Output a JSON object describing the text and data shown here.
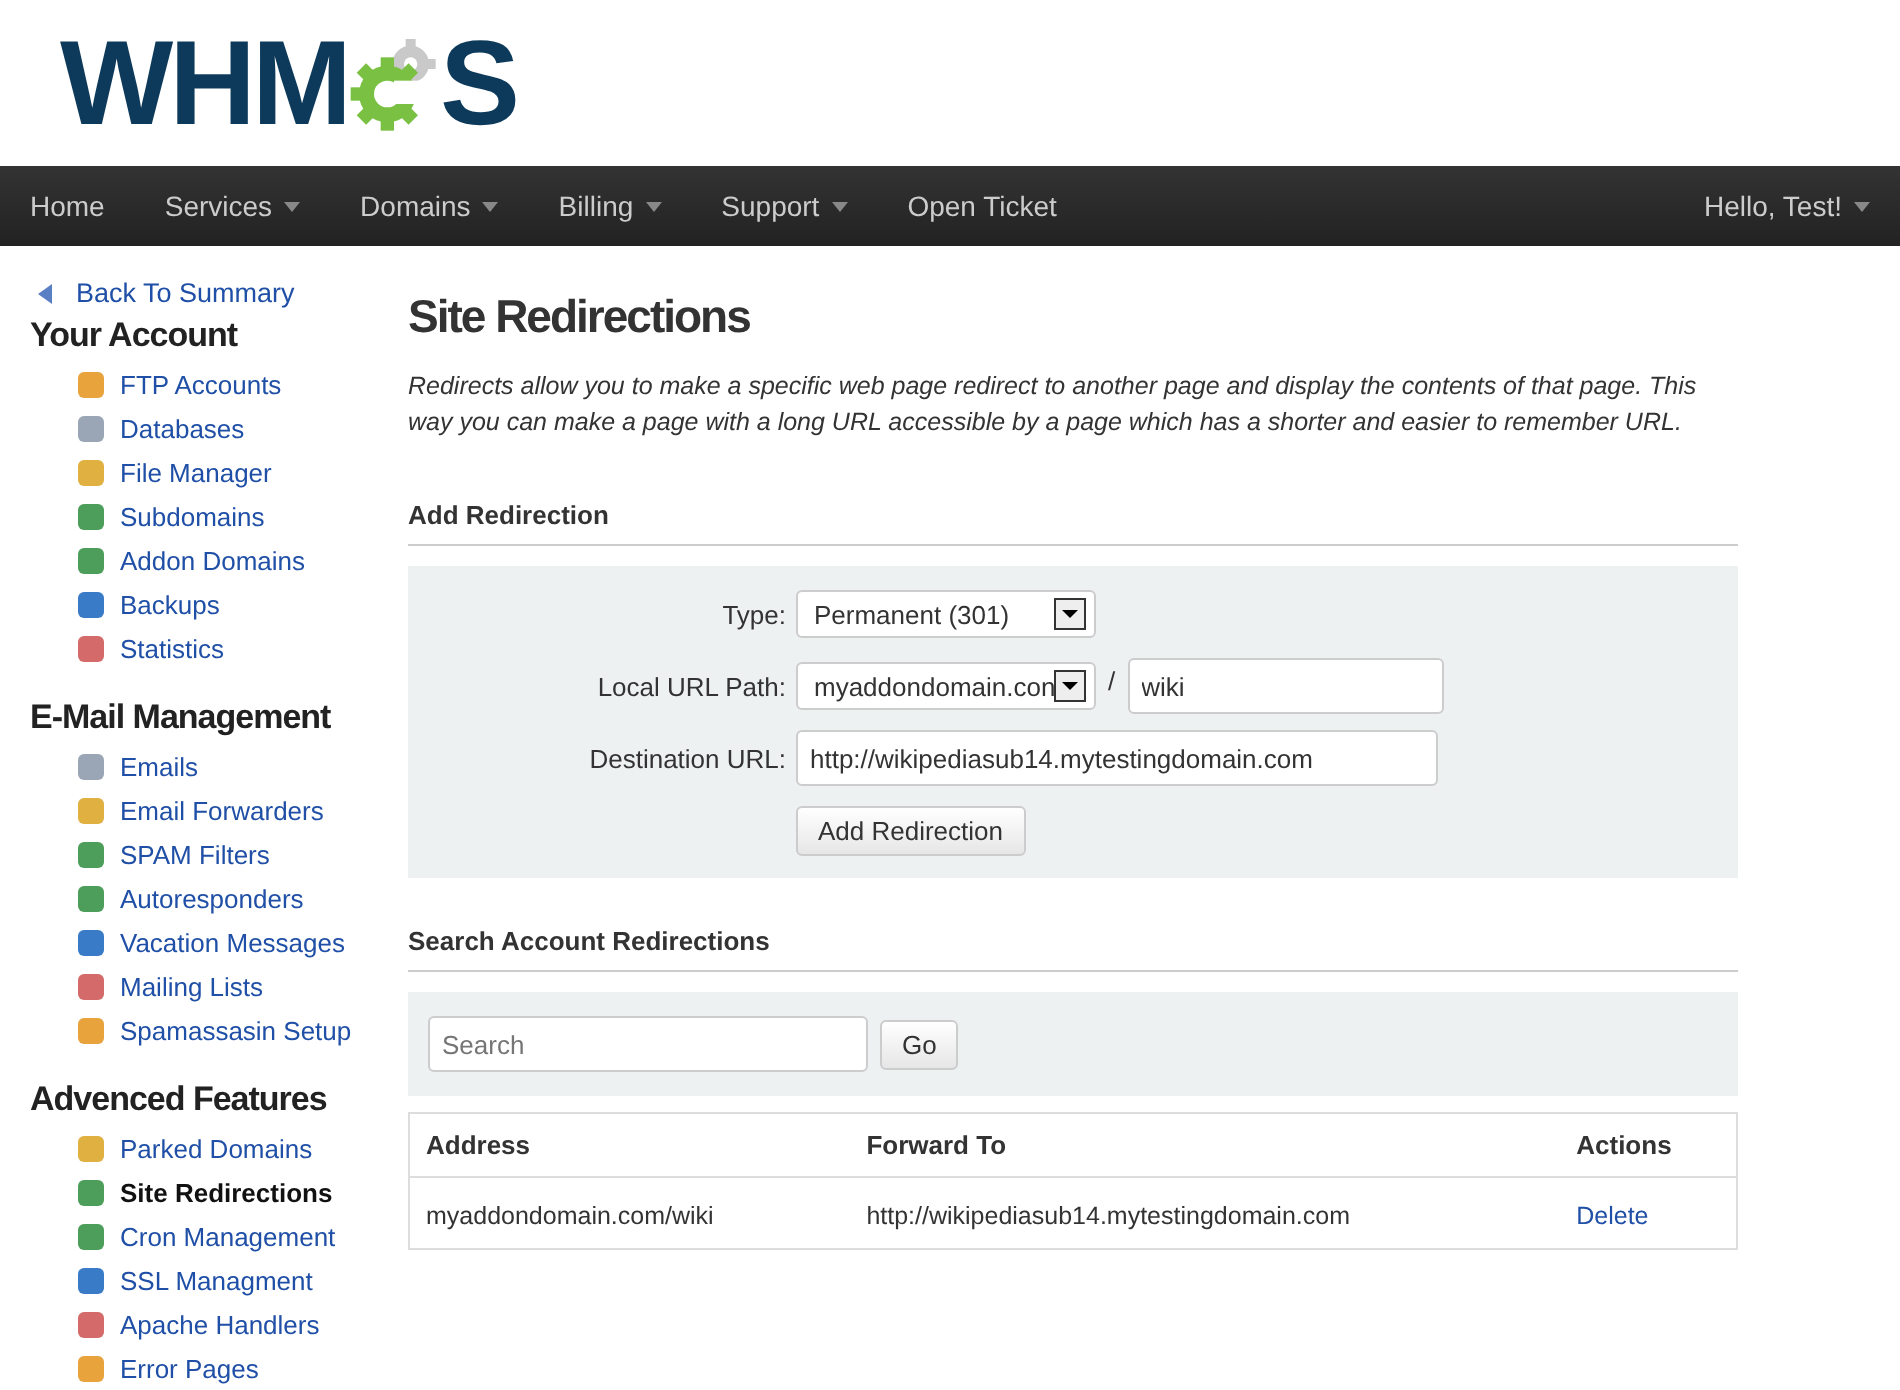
{
  "logo": {
    "left": "WHM",
    "right": "S"
  },
  "nav": {
    "items": [
      {
        "label": "Home",
        "dropdown": false
      },
      {
        "label": "Services",
        "dropdown": true
      },
      {
        "label": "Domains",
        "dropdown": true
      },
      {
        "label": "Billing",
        "dropdown": true
      },
      {
        "label": "Support",
        "dropdown": true
      },
      {
        "label": "Open Ticket",
        "dropdown": false
      }
    ],
    "user": {
      "label": "Hello, Test!",
      "dropdown": true
    }
  },
  "sidebar": {
    "back": "Back To Summary",
    "sections": [
      {
        "title": "Your Account",
        "items": [
          {
            "label": "FTP Accounts",
            "selected": false
          },
          {
            "label": "Databases",
            "selected": false
          },
          {
            "label": "File Manager",
            "selected": false
          },
          {
            "label": "Subdomains",
            "selected": false
          },
          {
            "label": "Addon Domains",
            "selected": false
          },
          {
            "label": "Backups",
            "selected": false
          },
          {
            "label": "Statistics",
            "selected": false
          }
        ]
      },
      {
        "title": "E-Mail Management",
        "items": [
          {
            "label": "Emails",
            "selected": false
          },
          {
            "label": "Email Forwarders",
            "selected": false
          },
          {
            "label": "SPAM Filters",
            "selected": false
          },
          {
            "label": "Autoresponders",
            "selected": false
          },
          {
            "label": "Vacation Messages",
            "selected": false
          },
          {
            "label": "Mailing Lists",
            "selected": false
          },
          {
            "label": "Spamassasin Setup",
            "selected": false
          }
        ]
      },
      {
        "title": "Advenced Features",
        "items": [
          {
            "label": "Parked Domains",
            "selected": false
          },
          {
            "label": "Site Redirections",
            "selected": true
          },
          {
            "label": "Cron Management",
            "selected": false
          },
          {
            "label": "SSL Managment",
            "selected": false
          },
          {
            "label": "Apache Handlers",
            "selected": false
          },
          {
            "label": "Error Pages",
            "selected": false
          }
        ]
      }
    ]
  },
  "main": {
    "title": "Site Redirections",
    "intro": "Redirects allow you to make a specific web page redirect to another page and display the contents of that page. This way you can make a page with a long URL accessible by a page which has a shorter and easier to remember URL.",
    "add": {
      "heading": "Add Redirection",
      "type_label": "Type:",
      "type_value": "Permanent (301)",
      "path_label": "Local URL Path:",
      "path_domain": "myaddondomain.con",
      "separator": "/",
      "path_value": "wiki",
      "dest_label": "Destination URL:",
      "dest_value": "http://wikipediasub14.mytestingdomain.com",
      "button": "Add Redirection"
    },
    "search": {
      "heading": "Search Account Redirections",
      "placeholder": "Search",
      "button": "Go"
    },
    "table": {
      "columns": [
        "Address",
        "Forward To",
        "Actions"
      ],
      "rows": [
        {
          "address": "myaddondomain.com/wiki",
          "forward": "http://wikipediasub14.mytestingdomain.com",
          "action": "Delete"
        }
      ]
    }
  }
}
